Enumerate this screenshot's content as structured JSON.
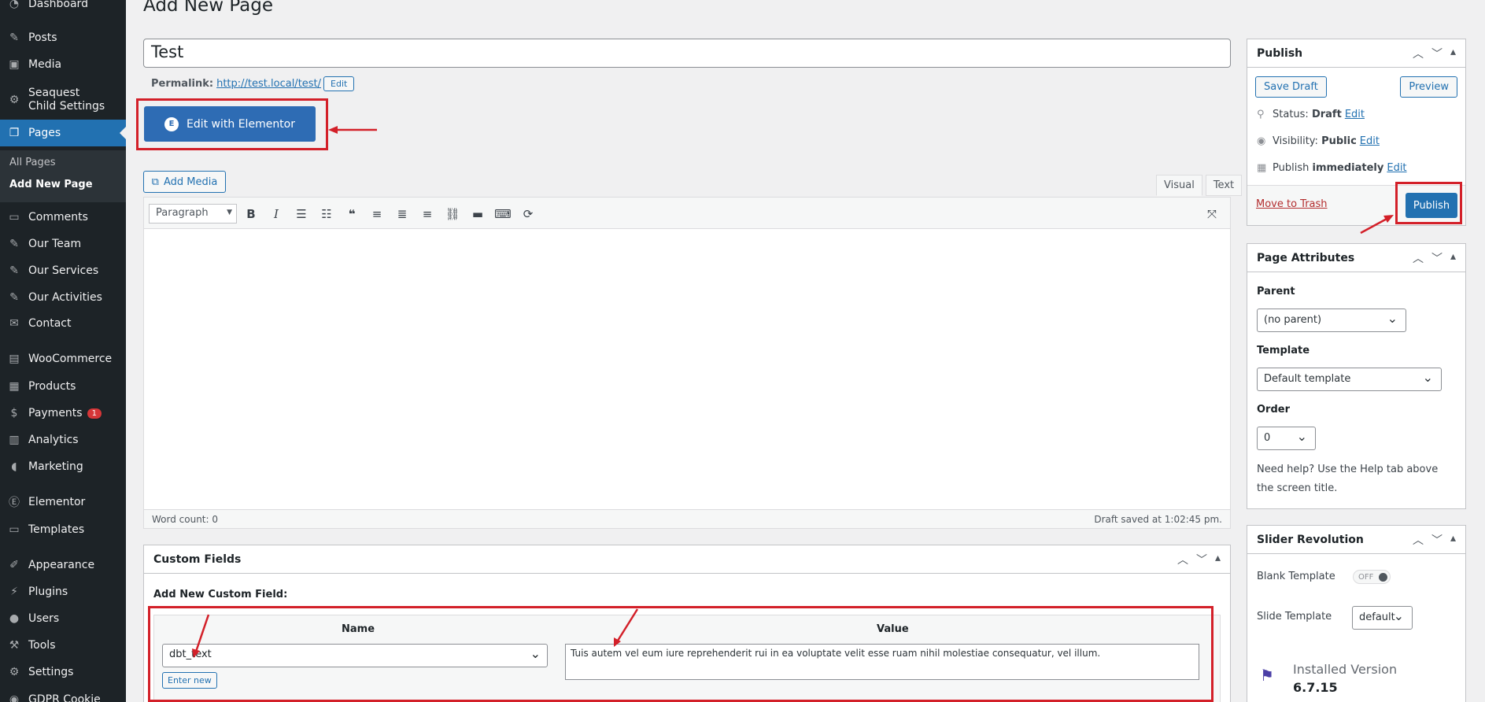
{
  "sidebar": {
    "items": [
      {
        "label": "Dashboard",
        "icon": "dashboard-icon"
      },
      {
        "label": "Posts",
        "icon": "pin-icon"
      },
      {
        "label": "Media",
        "icon": "media-icon"
      },
      {
        "label": "Seaquest Child Settings",
        "icon": "gear-icon"
      },
      {
        "label": "Pages",
        "icon": "pages-icon"
      },
      {
        "label": "Comments",
        "icon": "comment-icon"
      },
      {
        "label": "Our Team",
        "icon": "pin-icon"
      },
      {
        "label": "Our Services",
        "icon": "pin-icon"
      },
      {
        "label": "Our Activities",
        "icon": "pin-icon"
      },
      {
        "label": "Contact",
        "icon": "mail-icon"
      },
      {
        "label": "WooCommerce",
        "icon": "woo-icon"
      },
      {
        "label": "Products",
        "icon": "archive-icon"
      },
      {
        "label": "Payments",
        "icon": "dollar-icon",
        "badge": "1"
      },
      {
        "label": "Analytics",
        "icon": "bar-chart-icon"
      },
      {
        "label": "Marketing",
        "icon": "megaphone-icon"
      },
      {
        "label": "Elementor",
        "icon": "elementor-icon"
      },
      {
        "label": "Templates",
        "icon": "folder-icon"
      },
      {
        "label": "Appearance",
        "icon": "brush-icon"
      },
      {
        "label": "Plugins",
        "icon": "plugin-icon"
      },
      {
        "label": "Users",
        "icon": "user-icon"
      },
      {
        "label": "Tools",
        "icon": "wrench-icon"
      },
      {
        "label": "Settings",
        "icon": "settings-icon"
      },
      {
        "label": "GDPR Cookie",
        "icon": "cookie-icon"
      }
    ],
    "submenu": {
      "all_pages": "All Pages",
      "add_new": "Add New Page"
    }
  },
  "page": {
    "heading": "Add New Page",
    "title_value": "Test",
    "permalink_label": "Permalink:",
    "permalink_url": "http://test.local/test/",
    "permalink_edit": "Edit",
    "elementor_button": "Edit with Elementor",
    "add_media": "Add Media",
    "tab_visual": "Visual",
    "tab_text": "Text",
    "format_select": "Paragraph",
    "word_count": "Word count: 0",
    "draft_saved": "Draft saved at 1:02:45 pm."
  },
  "custom_fields": {
    "title": "Custom Fields",
    "add_new_label": "Add New Custom Field:",
    "name_header": "Name",
    "value_header": "Value",
    "name_value": "dbt_text",
    "value_text": "Tuis autem vel eum iure reprehenderit rui in ea voluptate velit esse ruam nihil molestiae consequatur, vel illum.",
    "enter_new": "Enter new"
  },
  "publish": {
    "title": "Publish",
    "save_draft": "Save Draft",
    "preview": "Preview",
    "status_label": "Status:",
    "status_value": "Draft",
    "visibility_label": "Visibility:",
    "visibility_value": "Public",
    "publish_label": "Publish",
    "publish_value": "immediately",
    "edit": "Edit",
    "move_to_trash": "Move to Trash",
    "publish_button": "Publish"
  },
  "page_attributes": {
    "title": "Page Attributes",
    "parent_label": "Parent",
    "parent_value": "(no parent)",
    "template_label": "Template",
    "template_value": "Default template",
    "order_label": "Order",
    "order_value": "0",
    "help": "Need help? Use the Help tab above the screen title."
  },
  "slider_revolution": {
    "title": "Slider Revolution",
    "blank_template": "Blank Template",
    "toggle": "OFF",
    "slide_template": "Slide Template",
    "slide_template_value": "default",
    "installed_label": "Installed Version",
    "installed_value": "6.7.15"
  },
  "colors": {
    "accent": "#2271b1",
    "annotation": "#d32029",
    "sidebar": "#1d2327"
  }
}
